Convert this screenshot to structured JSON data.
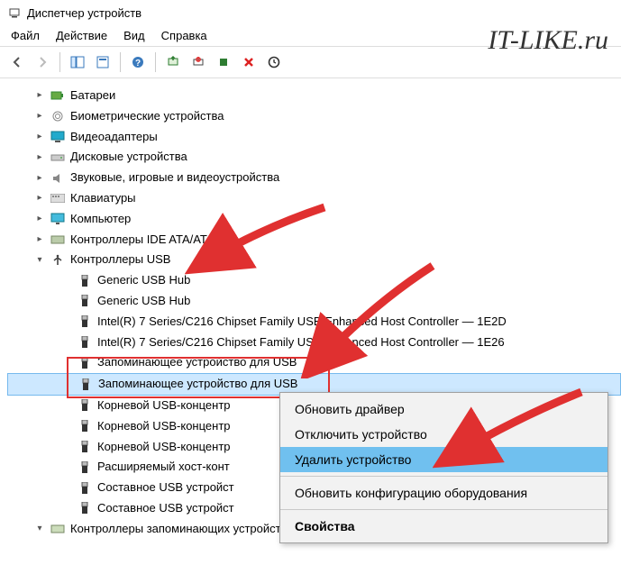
{
  "window": {
    "title": "Диспетчер устройств"
  },
  "menu": {
    "file": "Файл",
    "action": "Действие",
    "view": "Вид",
    "help": "Справка"
  },
  "watermark": "IT-LIKE.ru",
  "tree": {
    "batteries": "Батареи",
    "biometric": "Биометрические устройства",
    "video": "Видеоадаптеры",
    "disks": "Дисковые устройства",
    "sound": "Звуковые, игровые и видеоустройства",
    "keyboards": "Клавиатуры",
    "computer": "Компьютер",
    "ide": "Контроллеры IDE ATA/ATAPI",
    "usb": "Контроллеры USB",
    "usb_children": {
      "hub1": "Generic USB Hub",
      "hub2": "Generic USB Hub",
      "intel1": "Intel(R) 7 Series/C216 Chipset Family USB Enhanced Host Controller — 1E2D",
      "intel2": "Intel(R) 7 Series/C216 Chipset Family USB Enhanced Host Controller — 1E26",
      "storage1": "Запоминающее устройство для USB",
      "storage2": "Запоминающее устройство для USB",
      "roothub1": "Корневой USB-концентр",
      "roothub2": "Корневой USB-концентр",
      "roothub3": "Корневой USB-концентр",
      "exthost": "Расширяемый хост-конт",
      "comp1": "Составное USB устройст",
      "comp2": "Составное USB устройст"
    },
    "storage_ctrls": "Контроллеры запоминающих устройств"
  },
  "context": {
    "update": "Обновить драйвер",
    "disable": "Отключить устройство",
    "uninstall": "Удалить устройство",
    "scan": "Обновить конфигурацию оборудования",
    "props": "Свойства"
  }
}
